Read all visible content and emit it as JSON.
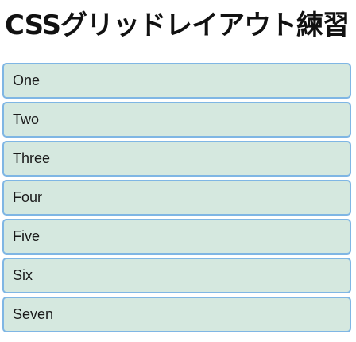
{
  "page": {
    "title": "CSSグリッドレイアウト練習"
  },
  "grid": {
    "items": [
      {
        "label": "One"
      },
      {
        "label": "Two"
      },
      {
        "label": "Three"
      },
      {
        "label": "Four"
      },
      {
        "label": "Five"
      },
      {
        "label": "Six"
      },
      {
        "label": "Seven"
      }
    ]
  },
  "colors": {
    "item_background": "#d5e8df",
    "item_border": "#7fb6e4",
    "text": "#1a1a1a"
  }
}
